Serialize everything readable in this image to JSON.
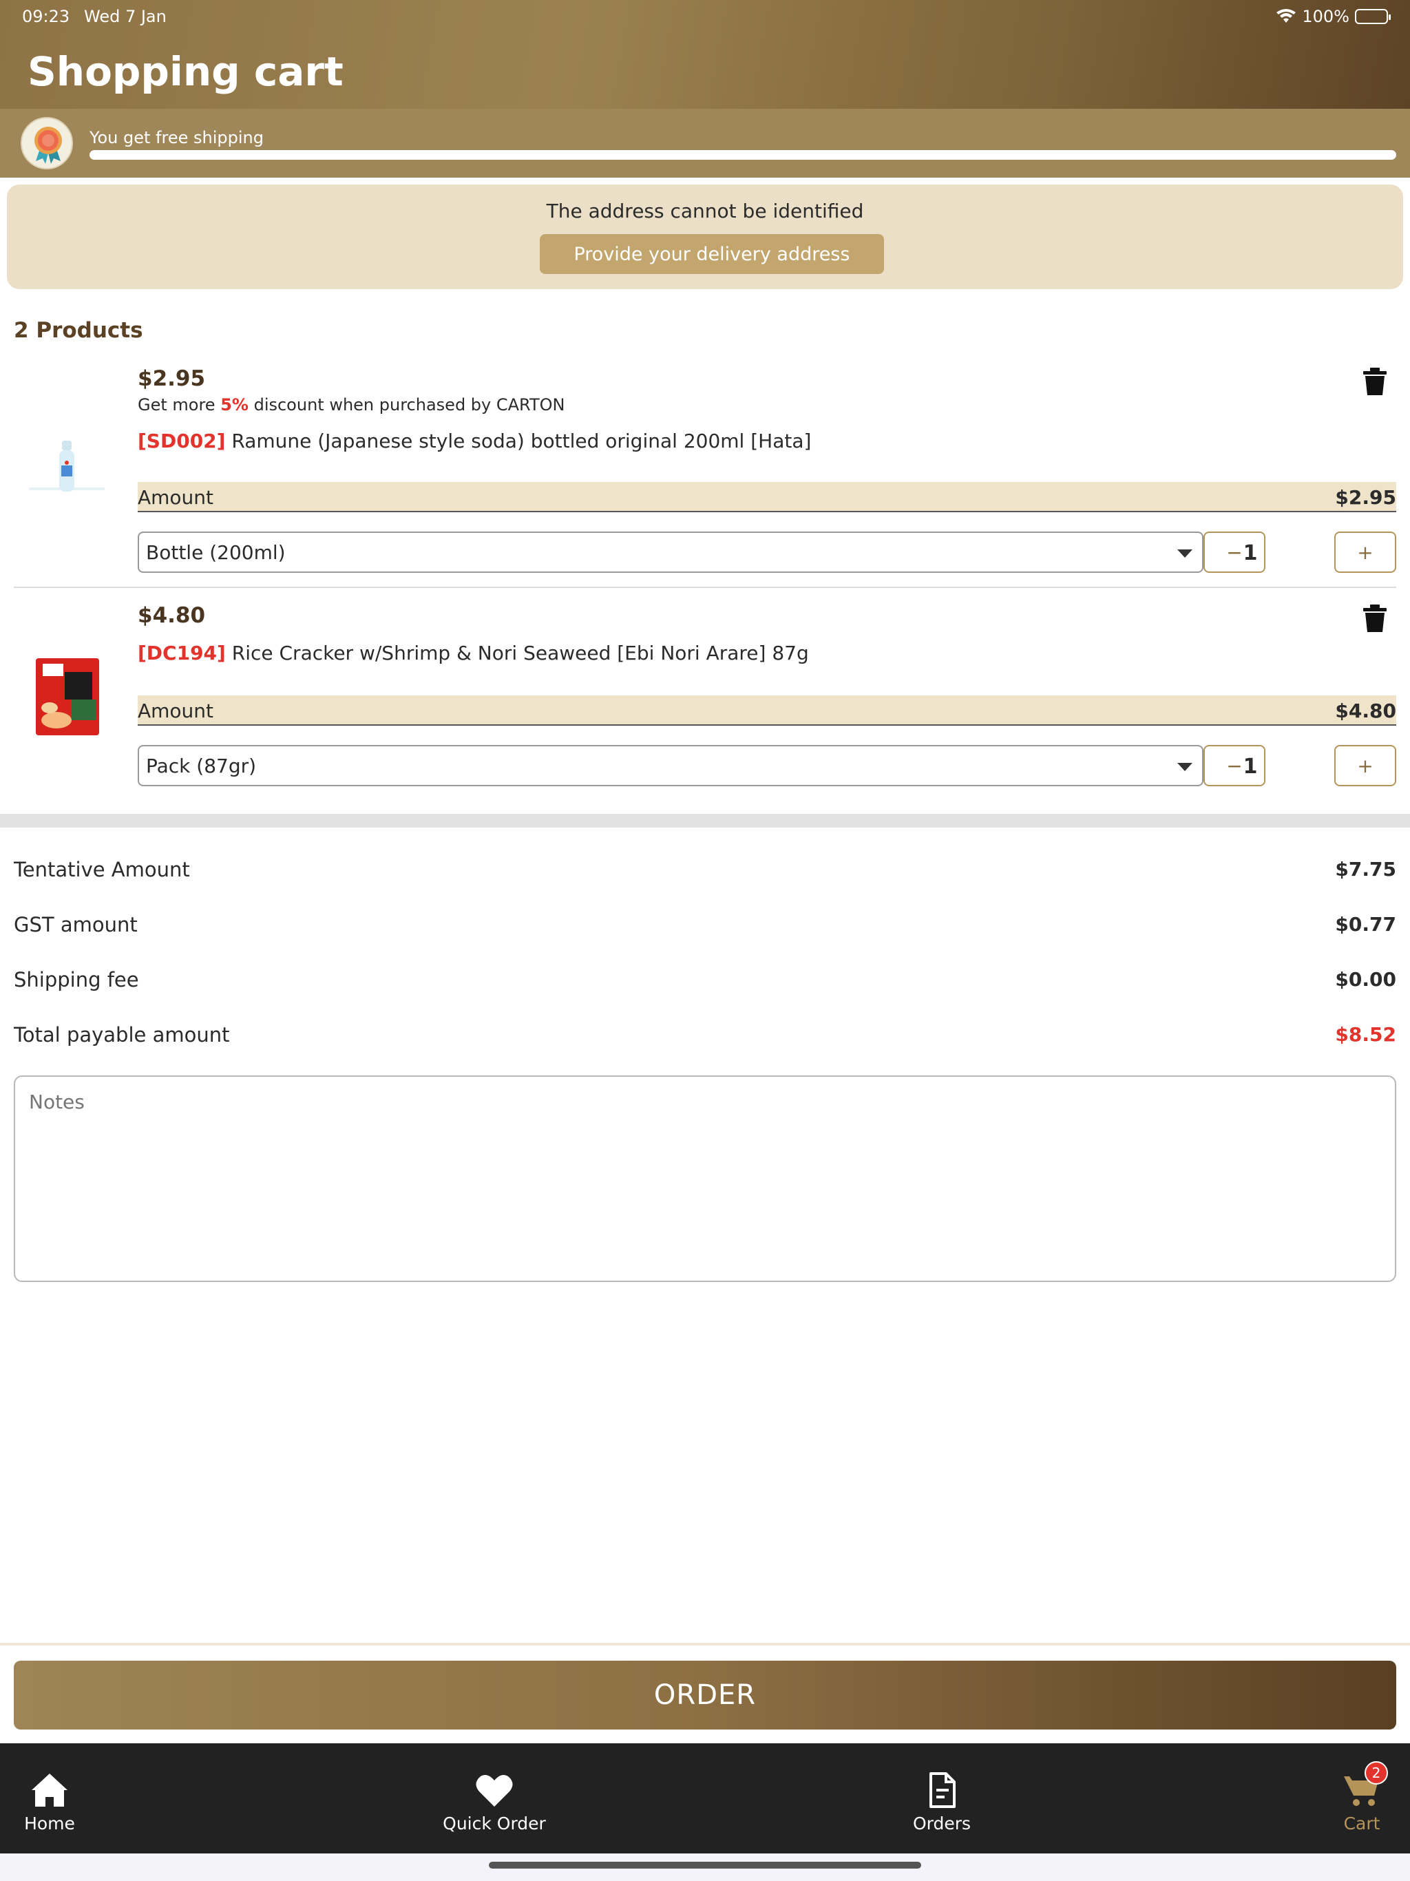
{
  "status_bar": {
    "time": "09:23",
    "date": "Wed 7 Jan",
    "battery": "100%"
  },
  "header": {
    "title": "Shopping cart"
  },
  "shipping": {
    "message": "You get free shipping",
    "progress_percent": 100
  },
  "address": {
    "message": "The address cannot be identified",
    "button_label": "Provide your delivery address"
  },
  "products": {
    "count_label": "2 Products",
    "items": [
      {
        "price": "$2.95",
        "discount_prefix": "Get more ",
        "discount_percent": "5%",
        "discount_suffix": " discount when purchased by CARTON",
        "code": "[SD002]",
        "name": " Ramune (Japanese style soda) bottled original 200ml [Hata]",
        "amount_label": "Amount",
        "amount_value": "$2.95",
        "unit": "Bottle (200ml)",
        "quantity": "1"
      },
      {
        "price": "$4.80",
        "code": "[DC194]",
        "name": " Rice Cracker w/Shrimp & Nori Seaweed [Ebi Nori Arare] 87g",
        "amount_label": "Amount",
        "amount_value": "$4.80",
        "unit": "Pack (87gr)",
        "quantity": "1"
      }
    ],
    "minus_label": "−",
    "plus_label": "+"
  },
  "summary": {
    "tentative_label": "Tentative Amount",
    "tentative_value": "$7.75",
    "gst_label": "GST amount",
    "gst_value": "$0.77",
    "shipping_label": "Shipping fee",
    "shipping_value": "$0.00",
    "total_label": "Total payable amount",
    "total_value": "$8.52"
  },
  "notes": {
    "placeholder": "Notes"
  },
  "order_button": "ORDER",
  "nav": {
    "home": "Home",
    "quick_order": "Quick Order",
    "orders": "Orders",
    "cart": "Cart",
    "cart_badge": "2"
  },
  "colors": {
    "accent": "#b59459",
    "brand_dark": "#5b4224",
    "price_red": "#e2332c"
  }
}
